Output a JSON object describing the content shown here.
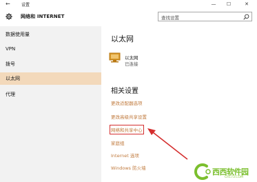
{
  "titlebar": {
    "back_glyph": "←",
    "title": "设置",
    "minimize_glyph": "—",
    "maximize_glyph": "☐",
    "close_glyph": "✕"
  },
  "header": {
    "title": "网络和 INTERNET",
    "icon": "gear-icon"
  },
  "search": {
    "placeholder": "查找设置",
    "icon": "search-icon"
  },
  "sidebar": {
    "items": [
      {
        "label": "数据使用量",
        "active": false
      },
      {
        "label": "VPN",
        "active": false
      },
      {
        "label": "拨号",
        "active": false
      },
      {
        "label": "以太网",
        "active": true
      },
      {
        "label": "代理",
        "active": false
      }
    ],
    "active_color": "#f3d9bb"
  },
  "main": {
    "heading": "以太网",
    "connection": {
      "name": "以太网",
      "status": "已连接",
      "icon": "ethernet-icon"
    },
    "related_heading": "相关设置",
    "links": [
      {
        "label": "更改适配器选项",
        "highlighted": false
      },
      {
        "label": "更改高级共享设置",
        "highlighted": false
      },
      {
        "label": "网络和共享中心",
        "highlighted": true
      },
      {
        "label": "家庭组",
        "highlighted": false
      },
      {
        "label": "Internet 选项",
        "highlighted": false
      },
      {
        "label": "Windows 防火墙",
        "highlighted": false
      }
    ],
    "link_color": "#c07a3d",
    "highlight_color": "#d42d2d"
  },
  "watermark": {
    "brand": "西西软件园",
    "url": "CR173.COM"
  }
}
